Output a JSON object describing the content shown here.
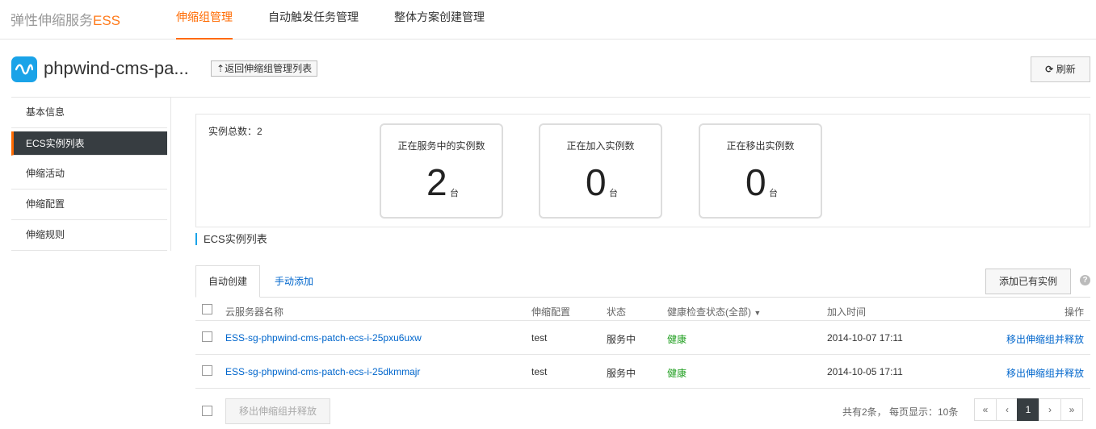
{
  "topbar": {
    "brand_text": "弹性伸缩服务",
    "brand_accent": "ESS",
    "tabs": [
      {
        "label": "伸缩组管理",
        "active": true
      },
      {
        "label": "自动触发任务管理",
        "active": false
      },
      {
        "label": "整体方案创建管理",
        "active": false
      }
    ]
  },
  "header": {
    "group_name": "phpwind-cms-pa...",
    "back_label": "返回伸缩组管理列表",
    "back_icon": "arrow-up-icon",
    "refresh_label": "刷新",
    "refresh_icon": "refresh-icon"
  },
  "sidebar": {
    "items": [
      {
        "label": "基本信息",
        "active": false
      },
      {
        "label": "ECS实例列表",
        "active": true
      },
      {
        "label": "伸缩活动",
        "active": false
      },
      {
        "label": "伸缩配置",
        "active": false
      },
      {
        "label": "伸缩规则",
        "active": false
      }
    ]
  },
  "summary": {
    "total_label": "实例总数：2",
    "stats": [
      {
        "label": "正在服务中的实例数",
        "value": "2",
        "unit": "台"
      },
      {
        "label": "正在加入实例数",
        "value": "0",
        "unit": "台"
      },
      {
        "label": "正在移出实例数",
        "value": "0",
        "unit": "台"
      }
    ]
  },
  "section": {
    "title": "ECS实例列表",
    "tabs": [
      "自动创建",
      "手动添加"
    ],
    "add_existing_label": "添加已有实例",
    "help_icon": "question-icon"
  },
  "table": {
    "columns": {
      "name": "云服务器名称",
      "config": "伸缩配置",
      "status": "状态",
      "health": "健康检查状态(全部)",
      "joined": "加入时间",
      "action": "操作"
    },
    "rows": [
      {
        "name": "ESS-sg-phpwind-cms-patch-ecs-i-25pxu6uxw",
        "config": "test",
        "status": "服务中",
        "health": "健康",
        "joined": "2014-10-07 17:11",
        "action": "移出伸缩组并释放"
      },
      {
        "name": "ESS-sg-phpwind-cms-patch-ecs-i-25dkmmajr",
        "config": "test",
        "status": "服务中",
        "health": "健康",
        "joined": "2014-10-05 17:11",
        "action": "移出伸缩组并释放"
      }
    ]
  },
  "footer": {
    "bulk_action_label": "移出伸缩组并释放",
    "pager_info": "共有2条， 每页显示：10条",
    "pager": [
      "«",
      "‹",
      "1",
      "›",
      "»"
    ],
    "current_page": "1"
  },
  "colors": {
    "accent": "#ff6a00",
    "link": "#0066cc",
    "healthy": "#1e9e1e",
    "sidebar_active": "#373d41",
    "logo": "#1aa3e8"
  }
}
